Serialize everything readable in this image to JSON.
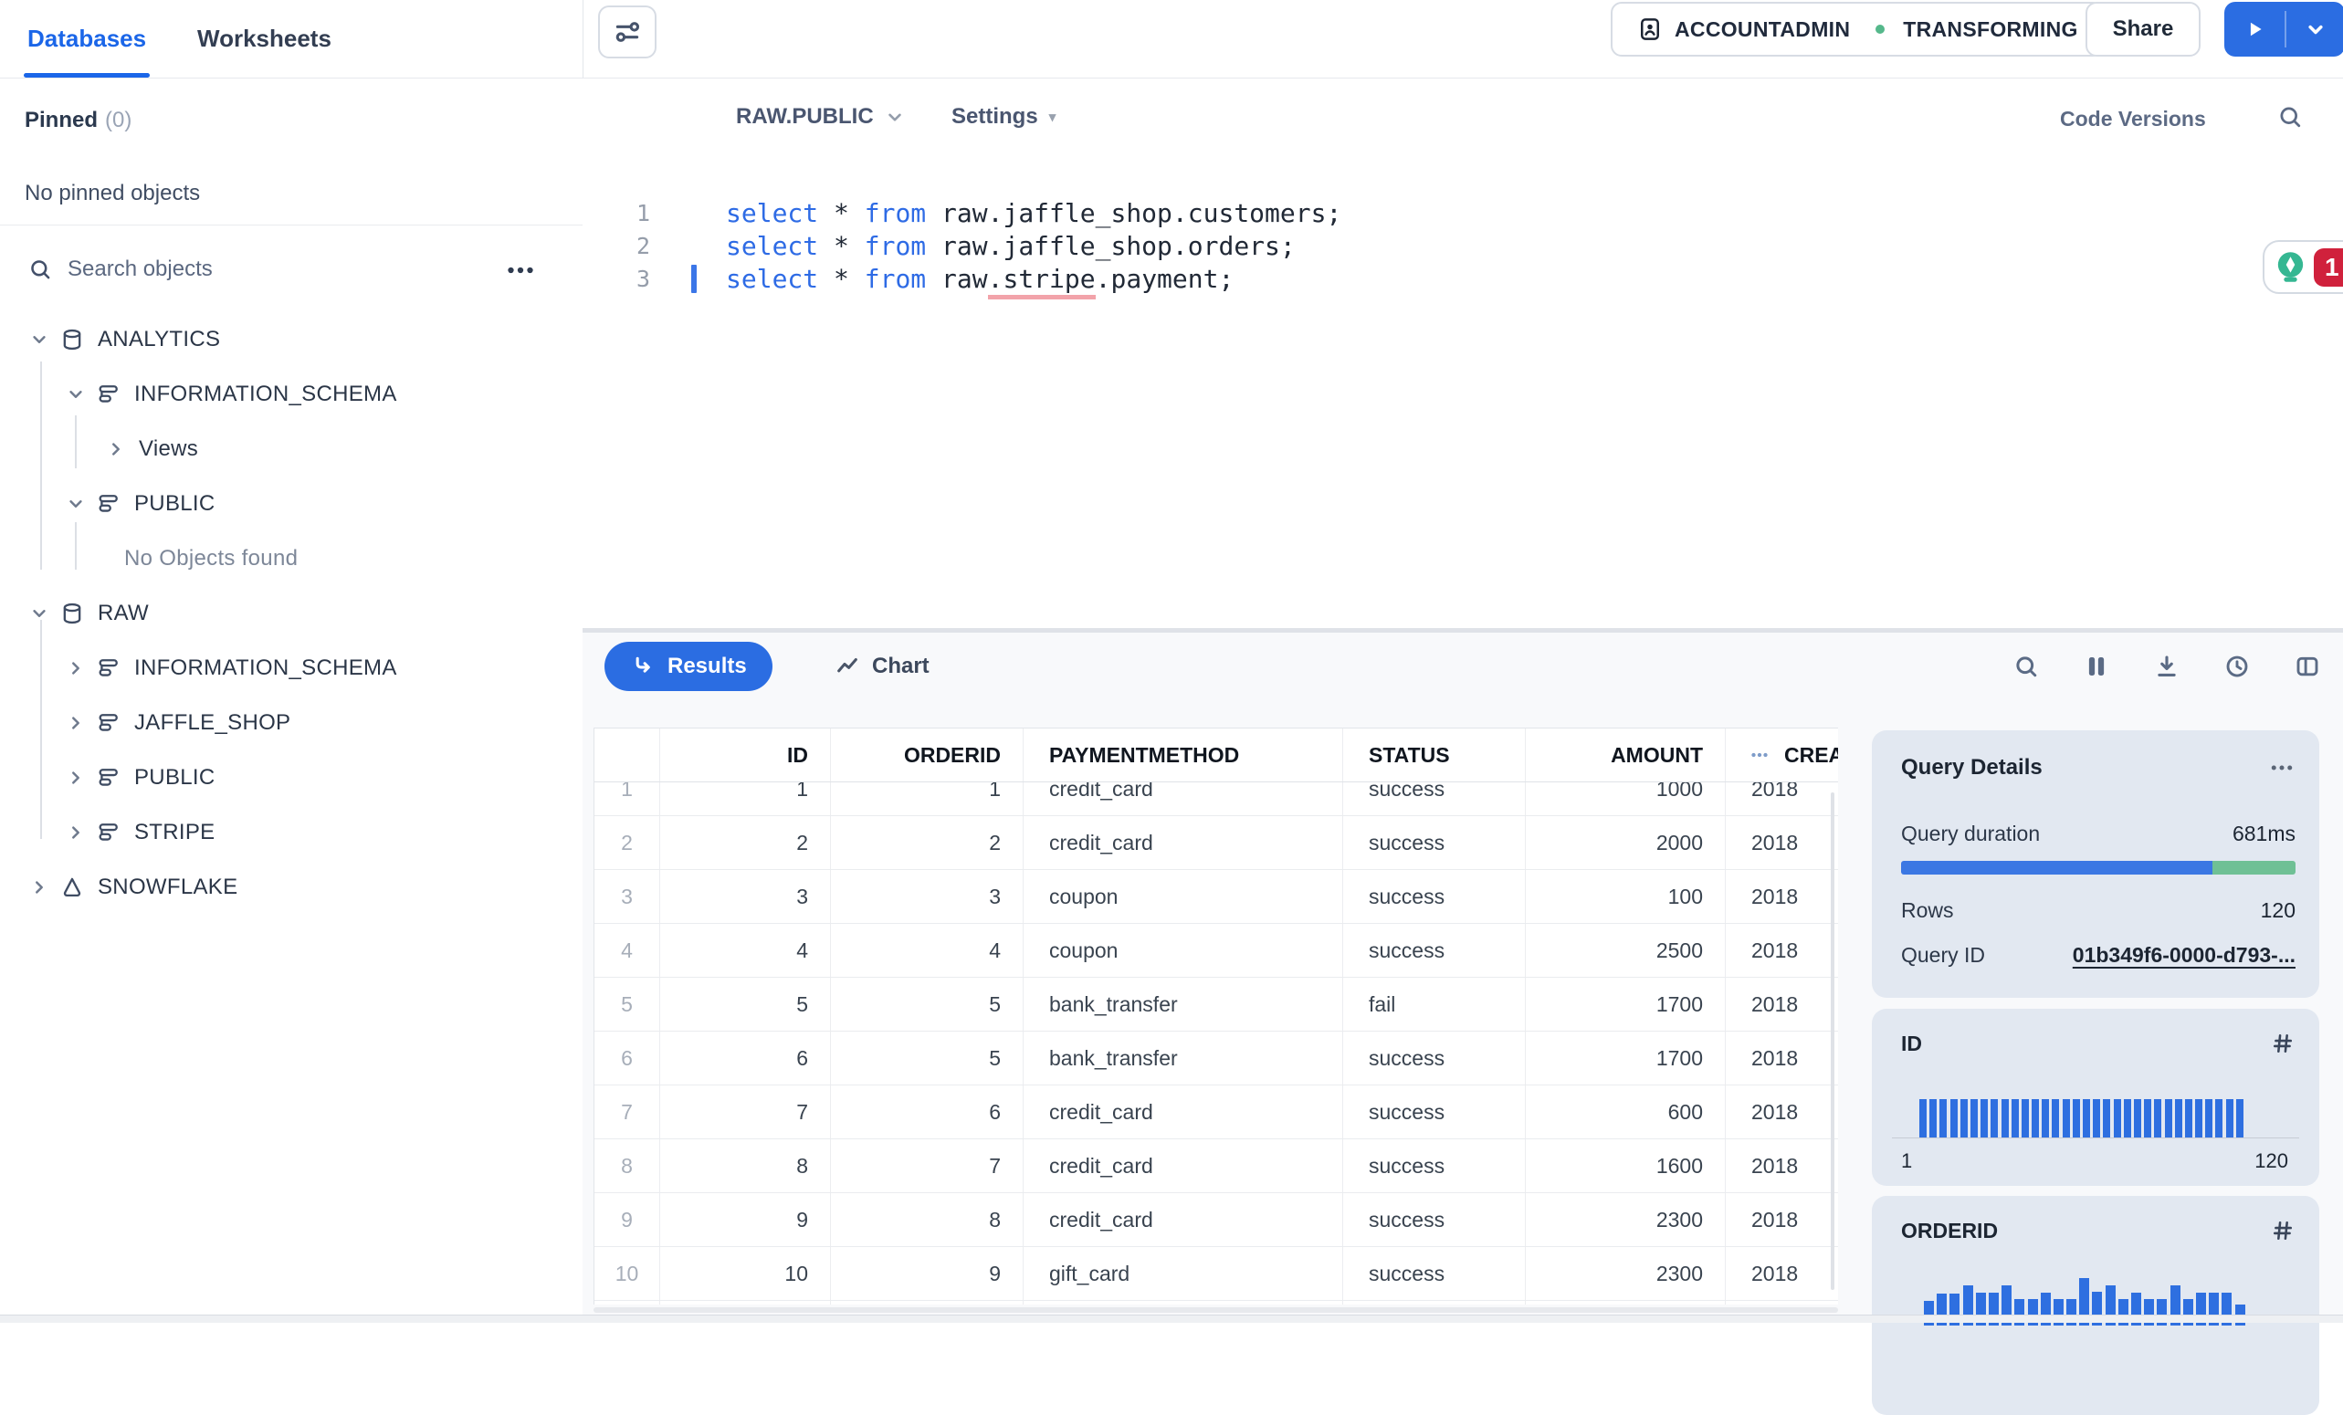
{
  "sidebar": {
    "tabs": [
      {
        "label": "Databases"
      },
      {
        "label": "Worksheets"
      }
    ],
    "pinned": {
      "label": "Pinned",
      "count": "(0)",
      "empty": "No pinned objects"
    },
    "search": {
      "placeholder": "Search objects"
    },
    "tree": [
      {
        "label": "ANALYTICS",
        "level": 0,
        "icon": "database",
        "expand": "open"
      },
      {
        "label": "INFORMATION_SCHEMA",
        "level": 1,
        "icon": "schema",
        "expand": "open"
      },
      {
        "label": "Views",
        "level": 2,
        "icon": null,
        "expand": "closed"
      },
      {
        "label": "PUBLIC",
        "level": 1,
        "icon": "schema",
        "expand": "open"
      },
      {
        "label": "No Objects found",
        "level": 2,
        "icon": null,
        "expand": null,
        "muted": true
      },
      {
        "label": "RAW",
        "level": 0,
        "icon": "database",
        "expand": "open"
      },
      {
        "label": "INFORMATION_SCHEMA",
        "level": 1,
        "icon": "schema",
        "expand": "closed"
      },
      {
        "label": "JAFFLE_SHOP",
        "level": 1,
        "icon": "schema",
        "expand": "closed"
      },
      {
        "label": "PUBLIC",
        "level": 1,
        "icon": "schema",
        "expand": "closed"
      },
      {
        "label": "STRIPE",
        "level": 1,
        "icon": "schema",
        "expand": "closed"
      },
      {
        "label": "SNOWFLAKE",
        "level": 0,
        "icon": "snowflake",
        "expand": "closed"
      }
    ]
  },
  "topbar": {
    "role": "ACCOUNTADMIN",
    "warehouse": "TRANSFORMING",
    "share_label": "Share"
  },
  "editor": {
    "database_context": "RAW.PUBLIC",
    "settings_label": "Settings",
    "code_versions_label": "Code Versions",
    "copilot_badge": "1",
    "lines": [
      {
        "num": "1",
        "cursor": false,
        "tokens": [
          {
            "text": "select",
            "type": "keyword"
          },
          {
            "text": " * ",
            "type": "plain"
          },
          {
            "text": "from",
            "type": "keyword"
          },
          {
            "text": " raw.jaffle_shop.customers;",
            "type": "plain"
          }
        ]
      },
      {
        "num": "2",
        "cursor": false,
        "tokens": [
          {
            "text": "select",
            "type": "keyword"
          },
          {
            "text": " * ",
            "type": "plain"
          },
          {
            "text": "from",
            "type": "keyword"
          },
          {
            "text": " raw.jaffle_shop.orders;",
            "type": "plain"
          }
        ]
      },
      {
        "num": "3",
        "cursor": true,
        "tokens": [
          {
            "text": "select",
            "type": "keyword"
          },
          {
            "text": " * ",
            "type": "plain"
          },
          {
            "text": "from",
            "type": "keyword"
          },
          {
            "text": " raw",
            "type": "plain"
          },
          {
            "text": ".stripe",
            "type": "error"
          },
          {
            "text": ".payment;",
            "type": "plain"
          }
        ]
      }
    ]
  },
  "results": {
    "results_tab": "Results",
    "chart_tab": "Chart"
  },
  "table": {
    "columns": [
      {
        "label": "",
        "align": "center"
      },
      {
        "label": "ID",
        "align": "right"
      },
      {
        "label": "ORDERID",
        "align": "right"
      },
      {
        "label": "PAYMENTMETHOD",
        "align": "left"
      },
      {
        "label": "STATUS",
        "align": "left"
      },
      {
        "label": "AMOUNT",
        "align": "right"
      },
      {
        "label": "CREATED",
        "align": "left",
        "menu_icon": true
      }
    ],
    "rows": [
      [
        "1",
        "1",
        "1",
        "credit_card",
        "success",
        "1000",
        "2018"
      ],
      [
        "2",
        "2",
        "2",
        "credit_card",
        "success",
        "2000",
        "2018"
      ],
      [
        "3",
        "3",
        "3",
        "coupon",
        "success",
        "100",
        "2018"
      ],
      [
        "4",
        "4",
        "4",
        "coupon",
        "success",
        "2500",
        "2018"
      ],
      [
        "5",
        "5",
        "5",
        "bank_transfer",
        "fail",
        "1700",
        "2018"
      ],
      [
        "6",
        "6",
        "5",
        "bank_transfer",
        "success",
        "1700",
        "2018"
      ],
      [
        "7",
        "7",
        "6",
        "credit_card",
        "success",
        "600",
        "2018"
      ],
      [
        "8",
        "8",
        "7",
        "credit_card",
        "success",
        "1600",
        "2018"
      ],
      [
        "9",
        "9",
        "8",
        "credit_card",
        "success",
        "2300",
        "2018"
      ],
      [
        "10",
        "10",
        "9",
        "gift_card",
        "success",
        "2300",
        "2018"
      ],
      [
        "",
        "",
        "",
        "",
        "",
        "",
        ""
      ]
    ]
  },
  "query_details": {
    "title": "Query Details",
    "duration_label": "Query duration",
    "duration_value": "681ms",
    "duration_breakdown": [
      {
        "color": "#3b77e3",
        "fraction": 0.79
      },
      {
        "color": "#6fc095",
        "fraction": 0.21
      }
    ],
    "rows_label": "Rows",
    "rows_value": "120",
    "query_id_label": "Query ID",
    "query_id_value": "01b349f6-0000-d793-..."
  },
  "chart_data": [
    {
      "type": "bar",
      "title": "ID",
      "xlabel": "",
      "ylabel": "",
      "x_range_labels": [
        "1",
        "120"
      ],
      "values": [
        1,
        1,
        1,
        1,
        1,
        1,
        1,
        1,
        1,
        1,
        1,
        1,
        1,
        1,
        1,
        1,
        1,
        1,
        1,
        1,
        1,
        1,
        1,
        1,
        1,
        1,
        1,
        1,
        1,
        1,
        1,
        1
      ]
    },
    {
      "type": "bar",
      "title": "ORDERID",
      "xlabel": "",
      "ylabel": "",
      "values": [
        0.52,
        0.68,
        0.68,
        0.84,
        0.7,
        0.7,
        0.84,
        0.56,
        0.56,
        0.7,
        0.56,
        0.56,
        1.0,
        0.72,
        0.84,
        0.56,
        0.7,
        0.56,
        0.56,
        0.84,
        0.56,
        0.7,
        0.7,
        0.7,
        0.44
      ]
    }
  ]
}
